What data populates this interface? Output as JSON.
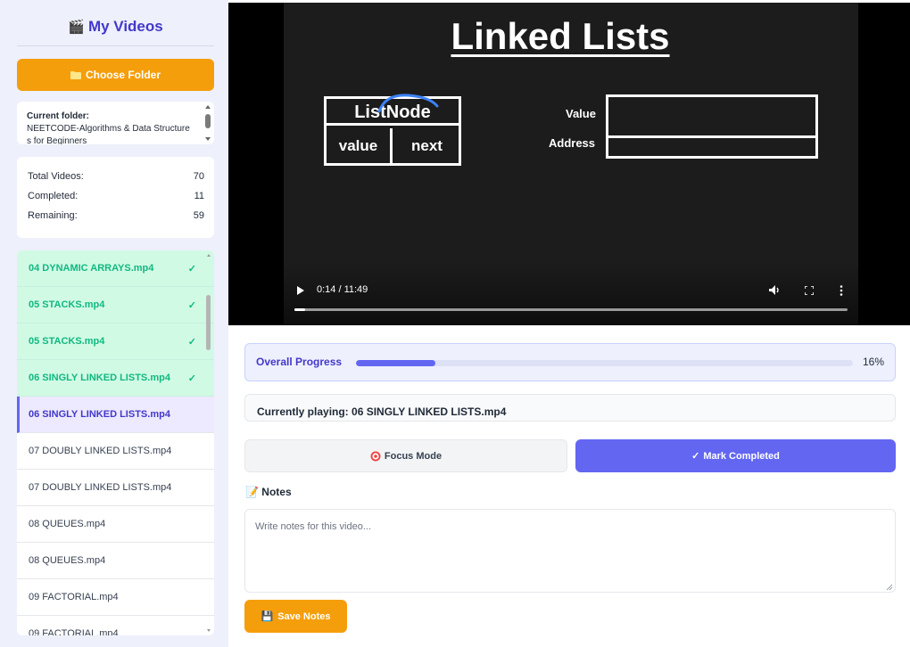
{
  "sidebar": {
    "icon": "clapperboard-icon",
    "title": "My Videos",
    "choose_folder_label": "Choose Folder",
    "folder_label": "Current folder:",
    "folder_value": "NEETCODE-Algorithms & Data Structures for Beginners",
    "stats": [
      {
        "label": "Total Videos:",
        "value": "70"
      },
      {
        "label": "Completed:",
        "value": "11"
      },
      {
        "label": "Remaining:",
        "value": "59"
      }
    ],
    "videos": [
      {
        "title": "04 DYNAMIC ARRAYS.mp4",
        "state": "completed"
      },
      {
        "title": "05 STACKS.mp4",
        "state": "completed"
      },
      {
        "title": "05 STACKS.mp4",
        "state": "completed"
      },
      {
        "title": "06 SINGLY LINKED LISTS.mp4",
        "state": "completed"
      },
      {
        "title": "06 SINGLY LINKED LISTS.mp4",
        "state": "playing"
      },
      {
        "title": "07 DOUBLY LINKED LISTS.mp4",
        "state": "pending"
      },
      {
        "title": "07 DOUBLY LINKED LISTS.mp4",
        "state": "pending"
      },
      {
        "title": "08 QUEUES.mp4",
        "state": "pending"
      },
      {
        "title": "08 QUEUES.mp4",
        "state": "pending"
      },
      {
        "title": "09 FACTORIAL.mp4",
        "state": "pending"
      },
      {
        "title": "09 FACTORIAL.mp4",
        "state": "pending"
      }
    ]
  },
  "player": {
    "slide": {
      "title": "Linked Lists",
      "node_label": "ListNode",
      "node_value": "value",
      "node_next": "next",
      "mem_value": "Value",
      "mem_address": "Address"
    },
    "time": "0:14 / 11:49",
    "played_fraction": 0.02
  },
  "progress": {
    "label": "Overall Progress",
    "percent_text": "16%",
    "fraction": 0.16
  },
  "now_playing": {
    "text": "Currently playing: 06 SINGLY LINKED LISTS.mp4"
  },
  "actions": {
    "focus_label": "Focus Mode",
    "mark_label": "Mark Completed"
  },
  "notes": {
    "title": "Notes",
    "placeholder": "Write notes for this video...",
    "save_label": "Save Notes"
  },
  "colors": {
    "accent": "#6366f1",
    "title": "#4338ca",
    "orange": "#f59e0b",
    "completed": "#10b981"
  }
}
